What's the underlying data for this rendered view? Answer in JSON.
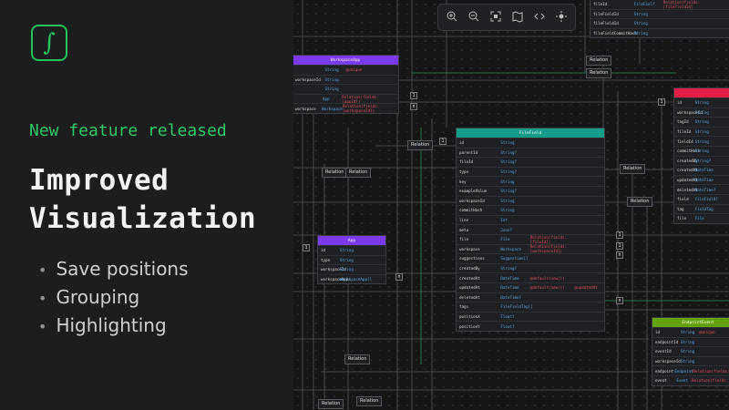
{
  "brand": {
    "logo_glyph": "∫",
    "accent": "#24c35c"
  },
  "tagline": "New feature released",
  "headline": [
    "Improved",
    "Visualization"
  ],
  "features": [
    "Save positions",
    "Grouping",
    "Highlighting"
  ],
  "toolbar": {
    "icons": [
      "zoom-in-icon",
      "zoom-out-icon",
      "fit-view-icon",
      "map-icon",
      "code-icon",
      "sun-icon"
    ]
  },
  "colors": {
    "workspaceapp": "#7c3aed",
    "filefield": "#139c8a",
    "red_table": "#e11d48",
    "endpoint": "#65a30d"
  },
  "tables": {
    "top": {
      "rows": [
        [
          "fileId",
          "FileFielf",
          "Relation(fields:[fileFieldId]",
          ""
        ],
        [
          "fileFieldId",
          "String",
          "",
          ""
        ],
        [
          "fileFieldId",
          "String",
          "",
          ""
        ],
        [
          "fileFieldCommitHash",
          "String",
          "",
          ""
        ]
      ]
    },
    "workspaceapp": {
      "title": "WorkspaceApp",
      "rows": [
        [
          "",
          "String",
          "@unique",
          ""
        ],
        [
          "workspaceId",
          "String",
          "",
          ""
        ],
        [
          "",
          "String",
          "",
          ""
        ],
        [
          "",
          "App",
          "Relation(fields:[appId])",
          ""
        ],
        [
          "workspace",
          "Workspace",
          "Relation(fields:[workspaceId])",
          ""
        ]
      ]
    },
    "app": {
      "title": "App",
      "rows": [
        [
          "id",
          "String",
          "",
          ""
        ],
        [
          "type",
          "String",
          "",
          ""
        ],
        [
          "workspaceId",
          "String",
          "",
          ""
        ],
        [
          "workspaceApps",
          "WorkspaceApp[]",
          "",
          ""
        ]
      ]
    },
    "filefield": {
      "title": "FileField",
      "rows": [
        [
          "id",
          "String",
          "",
          ""
        ],
        [
          "parentId",
          "String?",
          "",
          ""
        ],
        [
          "fileId",
          "String?",
          "",
          ""
        ],
        [
          "type",
          "String?",
          "",
          ""
        ],
        [
          "key",
          "String",
          "",
          ""
        ],
        [
          "exampleValue",
          "String?",
          "",
          ""
        ],
        [
          "workspaceId",
          "String",
          "",
          ""
        ],
        [
          "commitHash",
          "String",
          "",
          ""
        ],
        [
          "line",
          "Int",
          "",
          ""
        ],
        [
          "meta",
          "Json?",
          "",
          ""
        ],
        [
          "file",
          "File",
          "Relation(fields:[fileId])",
          ""
        ],
        [
          "workspace",
          "Workspace",
          "Relation(fields:[workspaceId])",
          ""
        ],
        [
          "suggestions",
          "Suggestion[]",
          "",
          ""
        ],
        [
          "createdBy",
          "String?",
          "",
          ""
        ],
        [
          "createdAt",
          "DateTime",
          "@default(now())",
          ""
        ],
        [
          "updatedAt",
          "DateTime",
          "@default(now())",
          "@updatedAt"
        ],
        [
          "deletedAt",
          "DateTime?",
          "",
          ""
        ],
        [
          "tags",
          "FileFieldTag[]",
          "",
          ""
        ],
        [
          "positionX",
          "Float?",
          "",
          ""
        ],
        [
          "positionY",
          "Float?",
          "",
          ""
        ]
      ]
    },
    "red": {
      "rows": [
        [
          "id",
          "String",
          "",
          ""
        ],
        [
          "workspaceId",
          "String",
          "",
          ""
        ],
        [
          "tagId",
          "String",
          "",
          ""
        ],
        [
          "fileId",
          "String",
          "",
          ""
        ],
        [
          "fieldId",
          "String",
          "",
          ""
        ],
        [
          "commitHash",
          "String",
          "",
          ""
        ],
        [
          "createdBy",
          "String?",
          "",
          ""
        ],
        [
          "createdAt",
          "DateTime",
          "",
          ""
        ],
        [
          "updatedAt",
          "DateTime",
          "",
          ""
        ],
        [
          "deletedAt",
          "DateTime?",
          "",
          ""
        ],
        [
          "field",
          "FileField?",
          "",
          ""
        ],
        [
          "tag",
          "FieldTag",
          "",
          ""
        ],
        [
          "file",
          "File",
          "",
          ""
        ]
      ]
    },
    "endpoint": {
      "title": "EndpointEvent",
      "rows": [
        [
          "id",
          "String",
          "@unique",
          ""
        ],
        [
          "endpointId",
          "String",
          "",
          ""
        ],
        [
          "eventId",
          "String",
          "",
          ""
        ],
        [
          "workspaceId",
          "String",
          "",
          ""
        ],
        [
          "endpoint",
          "Endpoint",
          "Relation(fields:",
          ""
        ],
        [
          "event",
          "Event",
          "Relation(fields:",
          ""
        ]
      ]
    }
  },
  "relation_label": "Relation",
  "mark_one": "1",
  "mark_many": "n"
}
